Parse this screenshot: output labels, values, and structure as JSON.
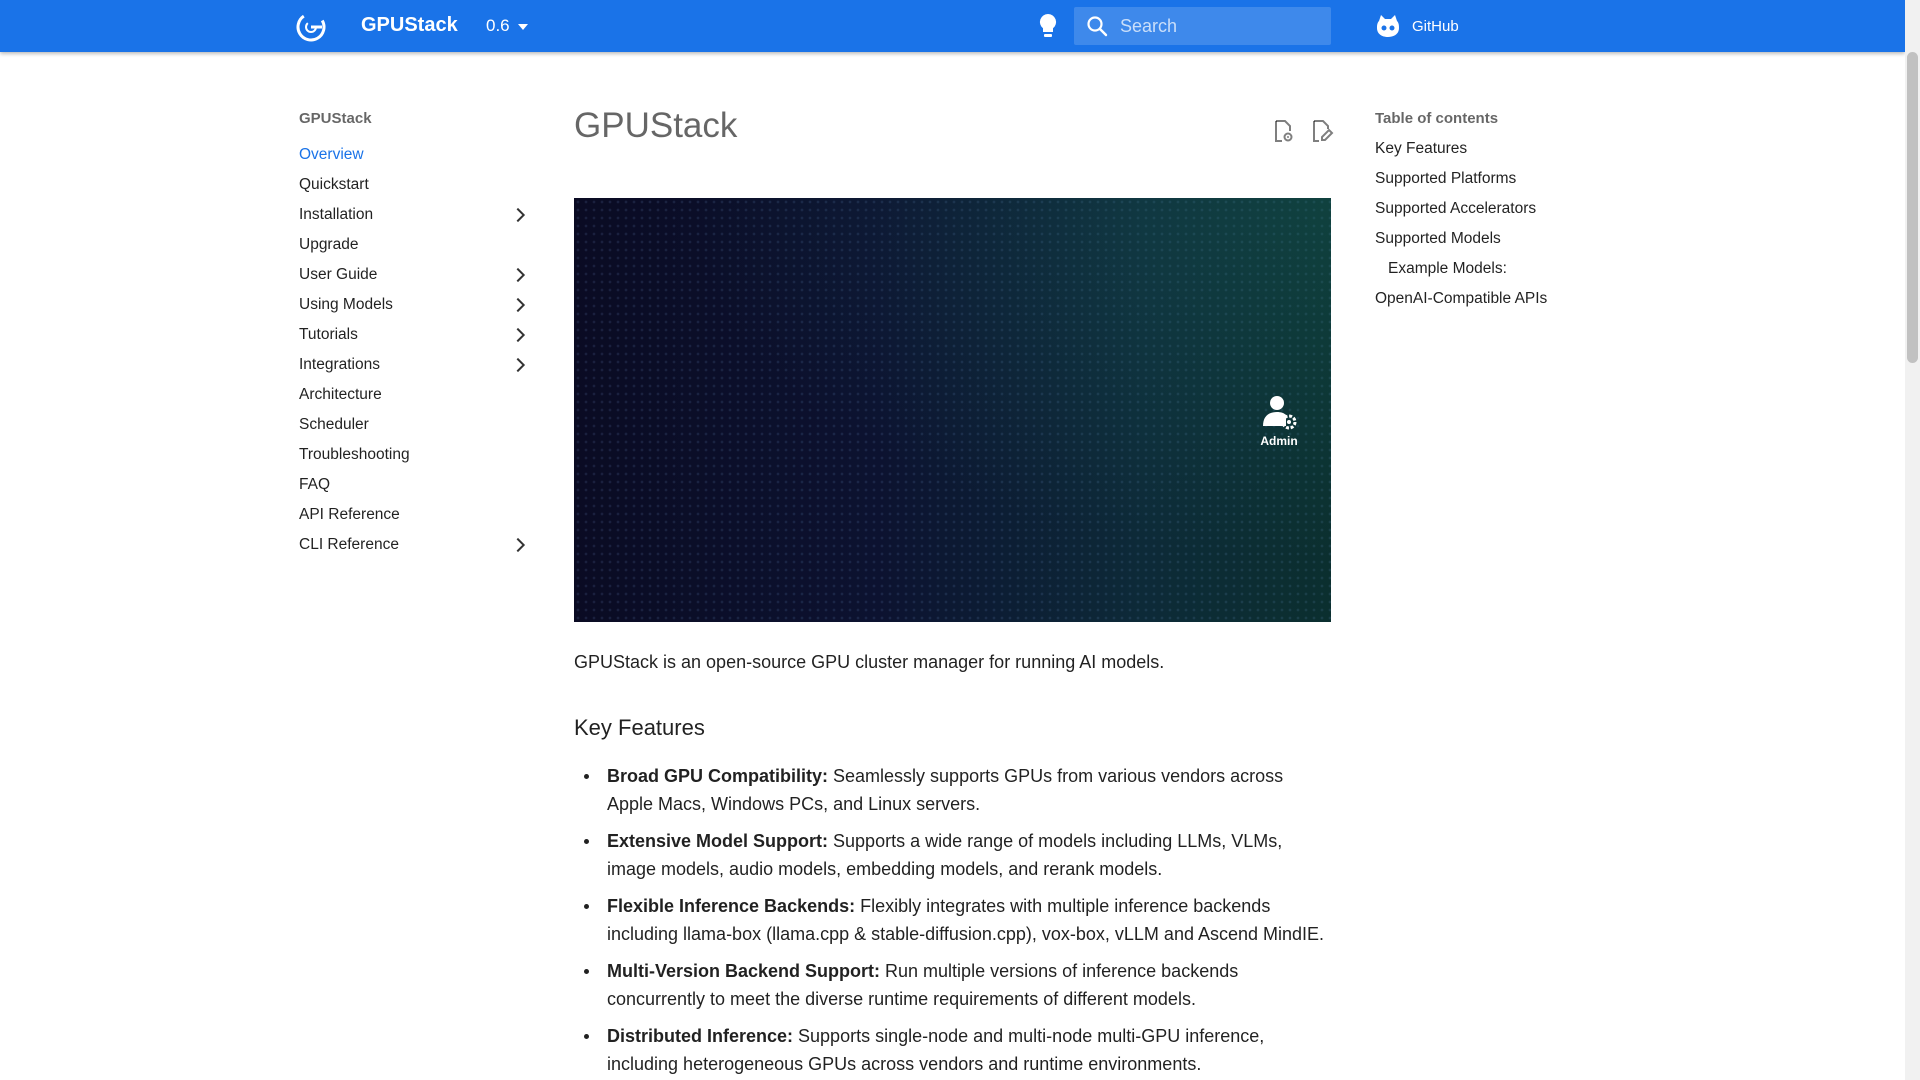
{
  "header": {
    "logo_icon": "gpustack-logo-icon",
    "site_name": "GPUStack",
    "version": "0.6",
    "search_placeholder": "Search",
    "github_label": "GitHub",
    "brand_color": "#1a73e8"
  },
  "nav": {
    "title": "GPUStack",
    "items": [
      {
        "label": "Overview",
        "active": true,
        "expandable": false
      },
      {
        "label": "Quickstart",
        "active": false,
        "expandable": false
      },
      {
        "label": "Installation",
        "active": false,
        "expandable": true
      },
      {
        "label": "Upgrade",
        "active": false,
        "expandable": false
      },
      {
        "label": "User Guide",
        "active": false,
        "expandable": true
      },
      {
        "label": "Using Models",
        "active": false,
        "expandable": true
      },
      {
        "label": "Tutorials",
        "active": false,
        "expandable": true
      },
      {
        "label": "Integrations",
        "active": false,
        "expandable": true
      },
      {
        "label": "Architecture",
        "active": false,
        "expandable": false
      },
      {
        "label": "Scheduler",
        "active": false,
        "expandable": false
      },
      {
        "label": "Troubleshooting",
        "active": false,
        "expandable": false
      },
      {
        "label": "FAQ",
        "active": false,
        "expandable": false
      },
      {
        "label": "API Reference",
        "active": false,
        "expandable": false
      },
      {
        "label": "CLI Reference",
        "active": false,
        "expandable": true
      }
    ]
  },
  "main": {
    "title": "GPUStack",
    "hero_badge": "Admin",
    "intro": "GPUStack is an open-source GPU cluster manager for running AI models.",
    "section_heading": "Key Features",
    "features": [
      {
        "title": "Broad GPU Compatibility:",
        "text": " Seamlessly supports GPUs from various vendors across Apple Macs, Windows PCs, and Linux servers."
      },
      {
        "title": "Extensive Model Support:",
        "text": " Supports a wide range of models including LLMs, VLMs, image models, audio models, embedding models, and rerank models."
      },
      {
        "title": "Flexible Inference Backends:",
        "text": " Flexibly integrates with multiple inference backends including llama-box (llama.cpp & stable-diffusion.cpp), vox-box, vLLM and Ascend MindIE."
      },
      {
        "title": "Multi-Version Backend Support:",
        "text": " Run multiple versions of inference backends concurrently to meet the diverse runtime requirements of different models."
      },
      {
        "title": "Distributed Inference:",
        "text": " Supports single-node and multi-node multi-GPU inference, including heterogeneous GPUs across vendors and runtime environments."
      }
    ]
  },
  "toc": {
    "title": "Table of contents",
    "items": [
      {
        "label": "Key Features",
        "level": 1
      },
      {
        "label": "Supported Platforms",
        "level": 1
      },
      {
        "label": "Supported Accelerators",
        "level": 1
      },
      {
        "label": "Supported Models",
        "level": 1
      },
      {
        "label": "Example Models:",
        "level": 2
      },
      {
        "label": "OpenAI-Compatible APIs",
        "level": 1
      }
    ]
  }
}
